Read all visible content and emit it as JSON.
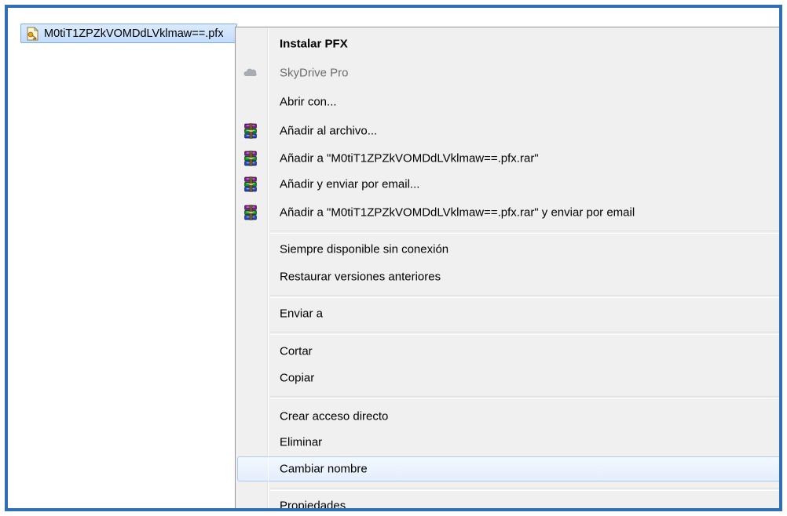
{
  "file": {
    "name": "M0tiT1ZPZkVOMDdLVklmaw==.pfx"
  },
  "menu": {
    "install_pfx": "Instalar PFX",
    "skydrive_pro": "SkyDrive Pro",
    "open_with": "Abrir con...",
    "add_to_archive": "Añadir al archivo...",
    "add_to_rar": "Añadir a \"M0tiT1ZPZkVOMDdLVklmaw==.pfx.rar\"",
    "add_and_email": "Añadir y enviar por email...",
    "add_to_rar_and_email": "Añadir a \"M0tiT1ZPZkVOMDdLVklmaw==.pfx.rar\" y enviar por email",
    "always_available_offline": "Siempre disponible sin conexión",
    "restore_previous_versions": "Restaurar versiones anteriores",
    "send_to": "Enviar a",
    "cut": "Cortar",
    "copy": "Copiar",
    "create_shortcut": "Crear acceso directo",
    "delete": "Eliminar",
    "rename": "Cambiar nombre",
    "properties": "Propiedades"
  },
  "colors": {
    "frame_border": "#2e6fb5",
    "menu_background": "#f0f0f0",
    "selection_border": "#84acdd",
    "hover_border": "#aeccf1"
  },
  "icons": {
    "file": "certificate-file-icon",
    "skydrive": "cloud-icon",
    "winrar": "winrar-books-icon"
  }
}
